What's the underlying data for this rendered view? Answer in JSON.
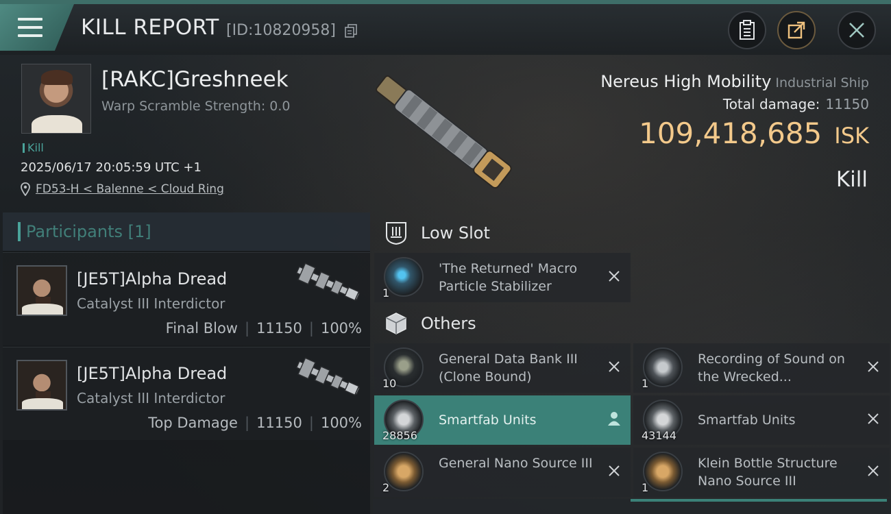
{
  "header": {
    "title": "KILL REPORT",
    "report_id": "[ID:10820958]",
    "icons": [
      "menu-icon",
      "copy-icon",
      "clipboard-icon",
      "share-icon",
      "close-icon"
    ]
  },
  "victim": {
    "name": "[RAKC]Greshneek",
    "warp_scramble": "Warp Scramble Strength: 0.0",
    "tag": "Kill",
    "timestamp": "2025/06/17 20:05:59 UTC +1",
    "location": "FD53-H < Balenne < Cloud Ring"
  },
  "ship": {
    "name": "Nereus High Mobility",
    "class": "Industrial Ship",
    "damage_label": "Total damage:",
    "damage_value": "11150",
    "isk_value": "109,418,685",
    "isk_unit": "ISK",
    "result": "Kill"
  },
  "participants": {
    "header": "Participants [1]",
    "rows": [
      {
        "name": "[JE5T]Alpha Dread",
        "ship": "Catalyst III Interdictor",
        "role": "Final Blow",
        "damage": "11150",
        "percent": "100%"
      },
      {
        "name": "[JE5T]Alpha Dread",
        "ship": "Catalyst III Interdictor",
        "role": "Top Damage",
        "damage": "11150",
        "percent": "100%"
      }
    ]
  },
  "sections": {
    "low_slot": "Low Slot",
    "others": "Others"
  },
  "items": {
    "low": [
      {
        "qty": "1",
        "name": "'The Returned' Macro Particle Stabilizer"
      }
    ],
    "others": [
      {
        "qty": "10",
        "name": "General Data Bank III (Clone Bound)"
      },
      {
        "qty": "1",
        "name": "Recording of Sound on the Wrecked..."
      },
      {
        "qty": "28856",
        "name": "Smartfab Units"
      },
      {
        "qty": "43144",
        "name": "Smartfab Units"
      },
      {
        "qty": "2",
        "name": "General Nano Source III"
      },
      {
        "qty": "1",
        "name": "Klein Bottle Structure Nano Source III"
      }
    ]
  },
  "colors": {
    "accent_teal": "#3b8178",
    "isk_gold": "#f3c98b"
  }
}
